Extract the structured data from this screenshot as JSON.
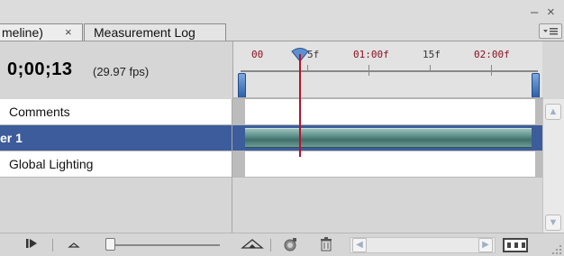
{
  "tabs": [
    {
      "label": "meline)",
      "close": "×",
      "active": true
    },
    {
      "label": "Measurement Log",
      "active": false
    }
  ],
  "window": {
    "minimize": "–",
    "close": "×",
    "menu_icon": "panel-menu-icon"
  },
  "timecode": {
    "value": "0;00;13",
    "fps": "(29.97 fps)"
  },
  "ruler": {
    "labels": [
      {
        "text": "00",
        "color": "#8a1020"
      },
      {
        "text": "5f",
        "color": "#333333"
      },
      {
        "text": "01:00f",
        "color": "#8a1020"
      },
      {
        "text": "15f",
        "color": "#333333"
      },
      {
        "text": "02:00f",
        "color": "#8a1020"
      }
    ],
    "playhead_color": "#b3142c",
    "range_handle_color": "#3d6fb8"
  },
  "layers": [
    {
      "name": "Comments",
      "selected": false
    },
    {
      "name": "er 1",
      "selected": true
    },
    {
      "name": "Global Lighting",
      "selected": false
    }
  ],
  "colors": {
    "selection": "#3d5c9c",
    "layer_bar": "#5d8f88"
  },
  "toolbar": {
    "buttons": [
      "next-frame-icon",
      "zoom-out-icon",
      "zoom-in-icon",
      "tween-icon",
      "delete-icon",
      "convert-to-frame-animation-icon"
    ]
  },
  "scrollbars": {
    "up": "▲",
    "down": "▼",
    "left": "◀",
    "right": "▶"
  }
}
